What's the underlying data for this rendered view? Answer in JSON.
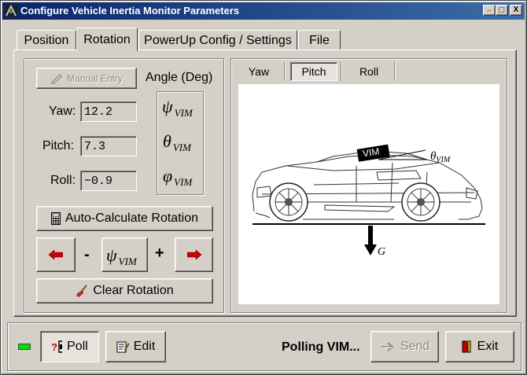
{
  "window": {
    "title": "Configure Vehicle Inertia Monitor Parameters",
    "minimize_glyph": "_",
    "maximize_glyph": "□",
    "close_glyph": "X"
  },
  "tabs": [
    {
      "label": "Position",
      "active": false
    },
    {
      "label": "Rotation",
      "active": true
    },
    {
      "label": "PowerUp Config / Settings",
      "active": false
    },
    {
      "label": "File",
      "active": false
    }
  ],
  "rotation": {
    "manual_entry_label": "Manual Entry",
    "angle_header": "Angle (Deg)",
    "fields": [
      {
        "label": "Yaw:",
        "value": "12.2",
        "symbol": "ψ",
        "subscript": "VIM"
      },
      {
        "label": "Pitch:",
        "value": "7.3",
        "symbol": "θ",
        "subscript": "VIM"
      },
      {
        "label": "Roll:",
        "value": "−0.9",
        "symbol": "φ",
        "subscript": "VIM"
      }
    ],
    "auto_calc_label": "Auto-Calculate Rotation",
    "minus_label": "-",
    "plus_label": "+",
    "step_symbol": "ψ",
    "step_subscript": "VIM",
    "clear_label": "Clear Rotation"
  },
  "view": {
    "subtabs": [
      {
        "label": "Yaw",
        "active": false
      },
      {
        "label": "Pitch",
        "active": true
      },
      {
        "label": "Roll",
        "active": false
      }
    ],
    "vim_label": "VIM",
    "theta_label": "θ",
    "theta_sub": "VIM",
    "gravity_label": "G"
  },
  "footer": {
    "poll_label": "Poll",
    "edit_label": "Edit",
    "status_text": "Polling VIM...",
    "send_label": "Send",
    "exit_label": "Exit",
    "status_led_color": "#00e000"
  }
}
